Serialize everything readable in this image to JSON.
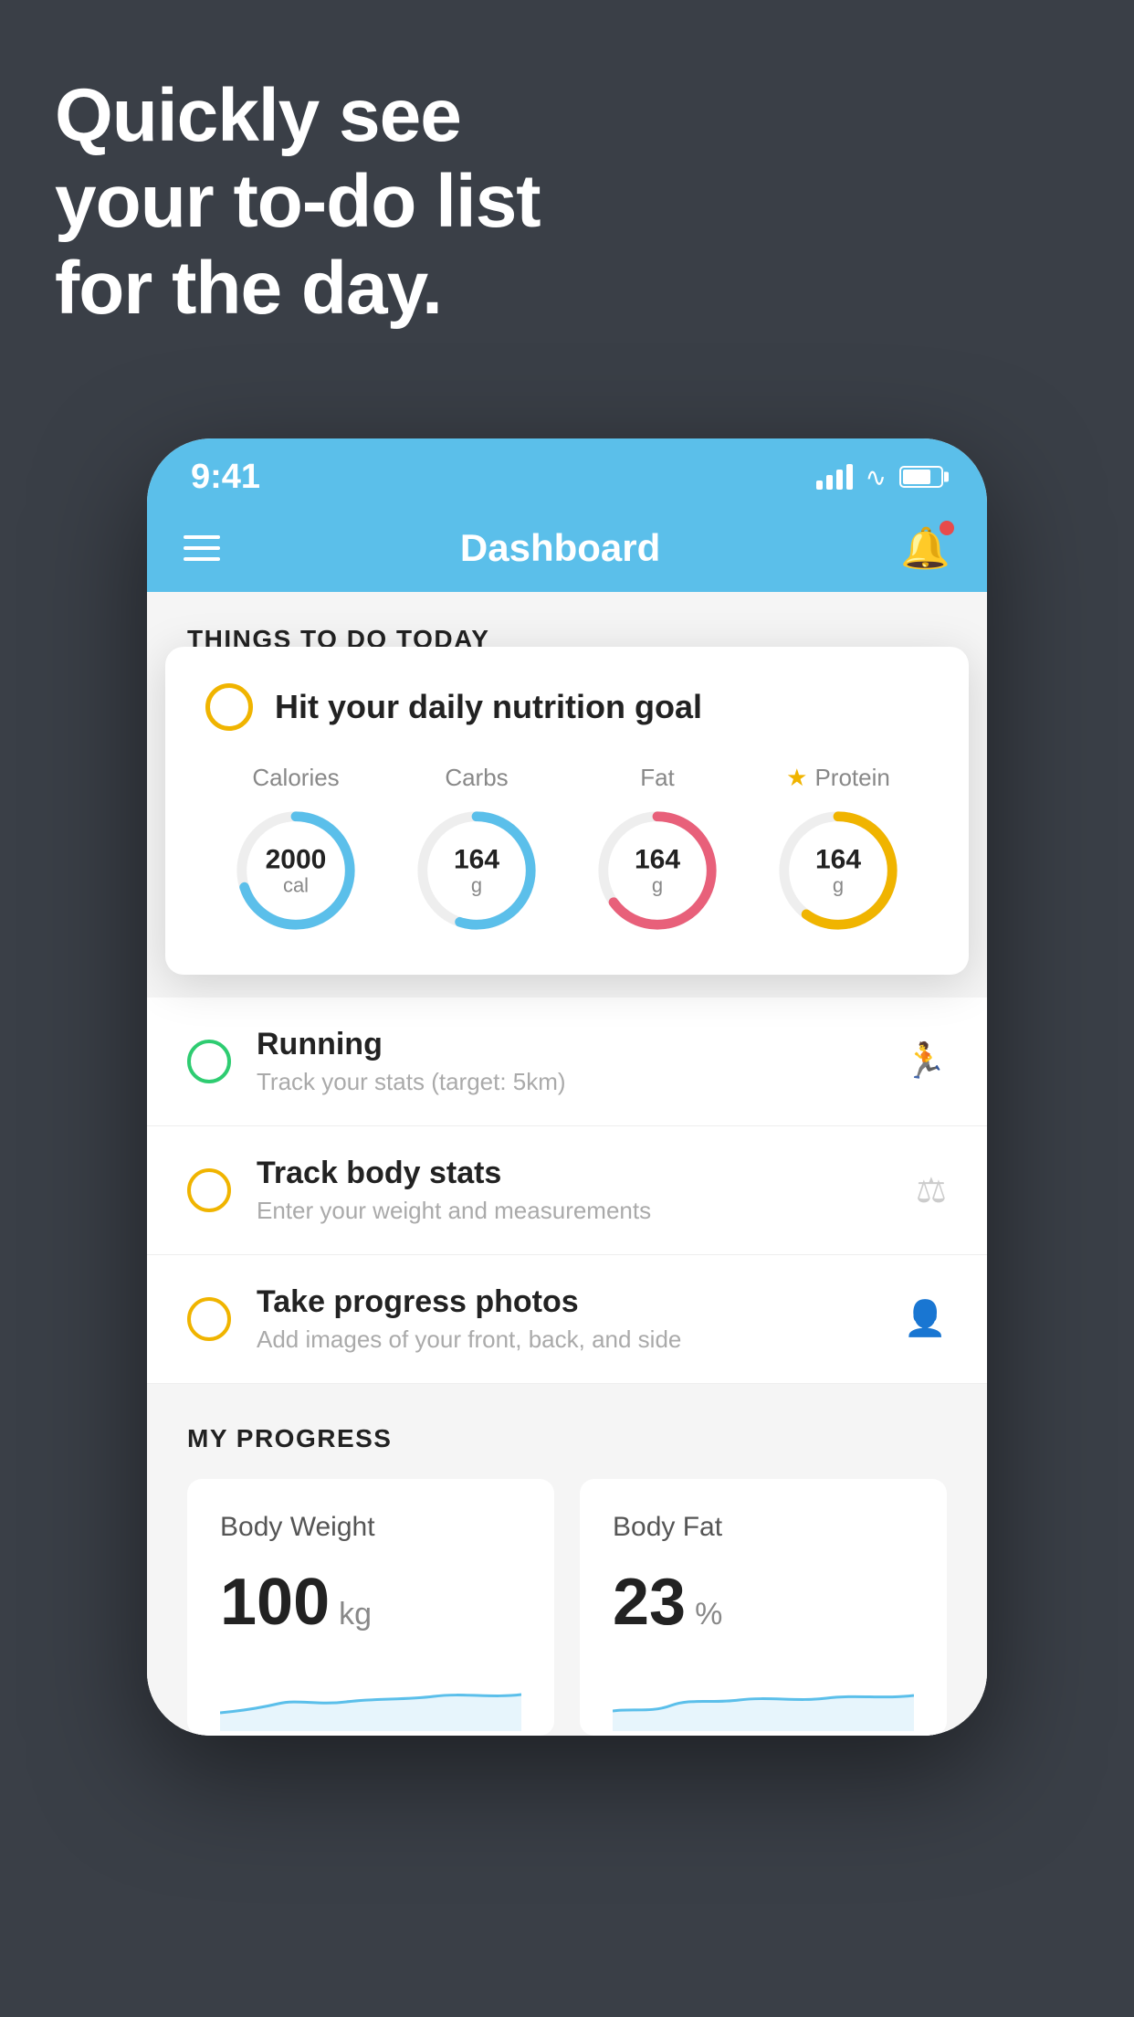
{
  "hero": {
    "line1": "Quickly see",
    "line2": "your to-do list",
    "line3": "for the day."
  },
  "phone": {
    "status_bar": {
      "time": "9:41"
    },
    "nav": {
      "title": "Dashboard"
    },
    "things_section": {
      "title": "THINGS TO DO TODAY"
    },
    "nutrition_card": {
      "title": "Hit your daily nutrition goal",
      "macros": [
        {
          "label": "Calories",
          "value": "2000",
          "unit": "cal",
          "color": "#5bbfea",
          "star": false,
          "percent": 70
        },
        {
          "label": "Carbs",
          "value": "164",
          "unit": "g",
          "color": "#5bbfea",
          "star": false,
          "percent": 55
        },
        {
          "label": "Fat",
          "value": "164",
          "unit": "g",
          "color": "#e8607a",
          "star": false,
          "percent": 65
        },
        {
          "label": "Protein",
          "value": "164",
          "unit": "g",
          "color": "#f0b400",
          "star": true,
          "percent": 60
        }
      ]
    },
    "todo_items": [
      {
        "title": "Running",
        "subtitle": "Track your stats (target: 5km)",
        "circle_color": "green",
        "icon": "🏃"
      },
      {
        "title": "Track body stats",
        "subtitle": "Enter your weight and measurements",
        "circle_color": "yellow",
        "icon": "⚖"
      },
      {
        "title": "Take progress photos",
        "subtitle": "Add images of your front, back, and side",
        "circle_color": "yellow",
        "icon": "👤"
      }
    ],
    "progress_section": {
      "title": "MY PROGRESS",
      "cards": [
        {
          "title": "Body Weight",
          "value": "100",
          "unit": "kg"
        },
        {
          "title": "Body Fat",
          "value": "23",
          "unit": "%"
        }
      ]
    }
  }
}
